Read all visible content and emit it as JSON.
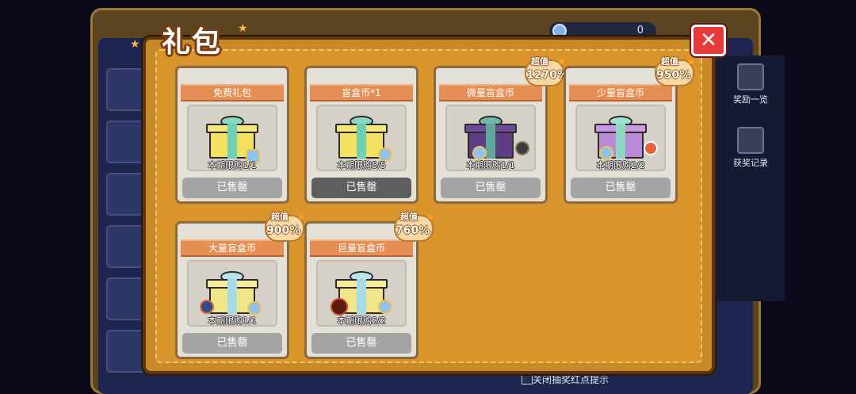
{
  "popup": {
    "title": "礼包",
    "close_label": "✕"
  },
  "background": {
    "currency_value": "0",
    "side_buttons": [
      {
        "label": "奖励一览",
        "icon": "chest-icon"
      },
      {
        "label": "获奖记录",
        "icon": "clipboard-icon"
      }
    ],
    "footer_text": "关闭抽奖红点提示"
  },
  "packages": [
    {
      "name": "免费礼包",
      "limit": "本期限购1/1",
      "status": "已售罄",
      "badge": null,
      "gift_color": "teal-yellow"
    },
    {
      "name": "盲盒币*1",
      "limit": "本期限购5/5",
      "status": "已售罄",
      "badge": null,
      "gift_color": "teal-yellow"
    },
    {
      "name": "微量盲盒币",
      "limit": "本期限购1/1",
      "status": "已售罄",
      "badge": {
        "label": "超值",
        "value": "1270%"
      },
      "gift_color": "purple"
    },
    {
      "name": "少量盲盒币",
      "limit": "本期限购2/2",
      "status": "已售罄",
      "badge": {
        "label": "超值",
        "value": "950%"
      },
      "gift_color": "violet"
    },
    {
      "name": "大量盲盒币",
      "limit": "本期限购1/1",
      "status": "已售罄",
      "badge": {
        "label": "超值",
        "value": "900%"
      },
      "gift_color": "blue-yellow"
    },
    {
      "name": "巨量盲盒币",
      "limit": "本期限购2/2",
      "status": "已售罄",
      "badge": {
        "label": "超值",
        "value": "760%"
      },
      "gift_color": "blue-yellow"
    }
  ],
  "colors": {
    "panel": "#c88a26",
    "ribbon": "#e58f55",
    "sold_button": "#a5a4a4",
    "close_button": "#e83a3a"
  }
}
